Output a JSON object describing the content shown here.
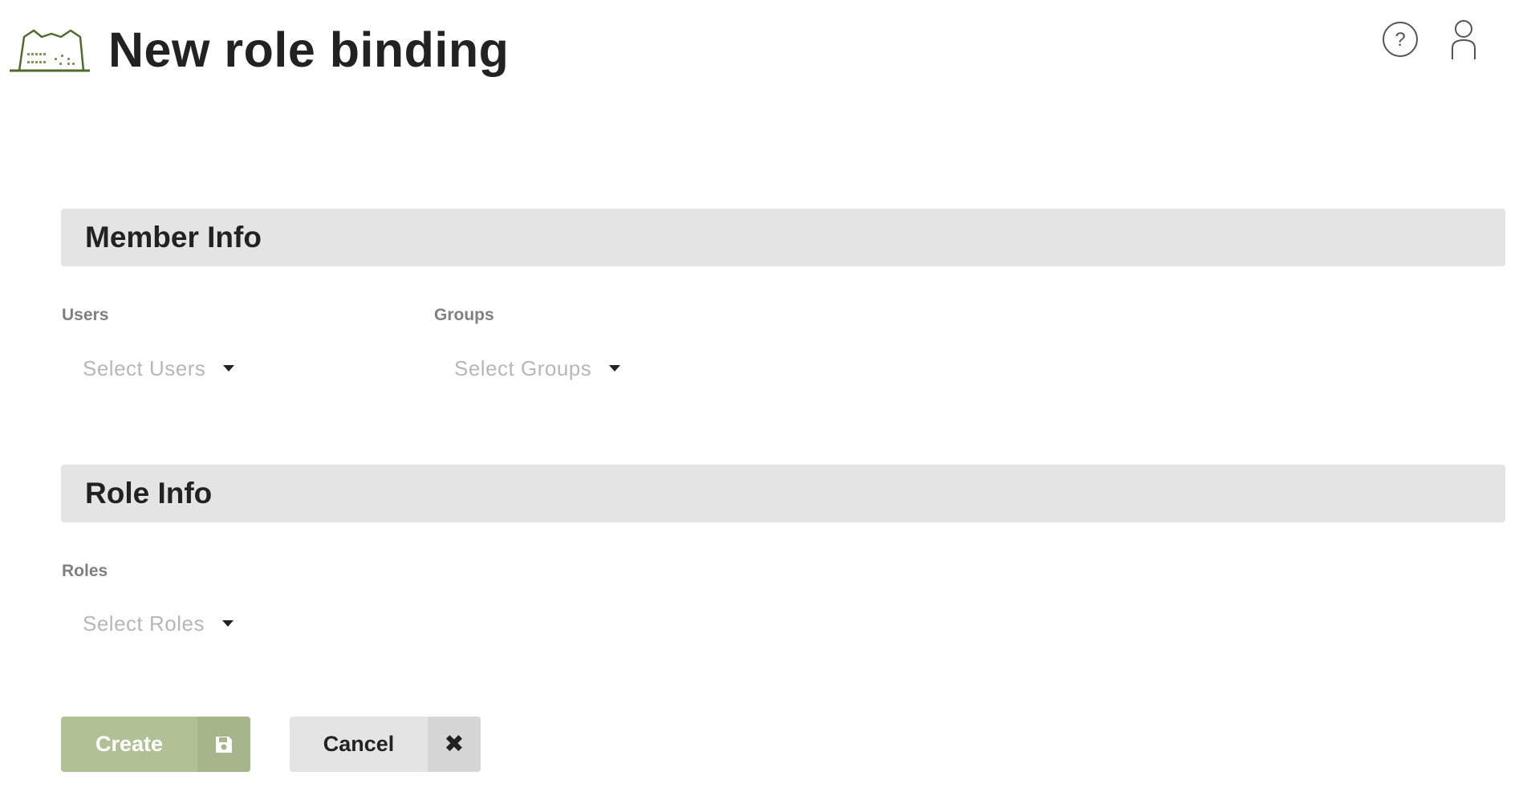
{
  "header": {
    "title": "New role binding",
    "logo_icon": "hat-logo-icon",
    "help_icon": "help-icon",
    "user_icon": "user-icon"
  },
  "sections": {
    "member_info": {
      "title": "Member Info",
      "users": {
        "label": "Users",
        "placeholder": "Select Users"
      },
      "groups": {
        "label": "Groups",
        "placeholder": "Select Groups"
      }
    },
    "role_info": {
      "title": "Role Info",
      "roles": {
        "label": "Roles",
        "placeholder": "Select Roles"
      }
    }
  },
  "actions": {
    "create_label": "Create",
    "create_icon": "save-icon",
    "cancel_label": "Cancel",
    "cancel_icon": "close-icon"
  },
  "colors": {
    "brand": "#4e6b2c",
    "create_button": "#b0c196",
    "section_background": "#e4e4e4",
    "label": "#808080",
    "placeholder": "#b7b7b7"
  }
}
